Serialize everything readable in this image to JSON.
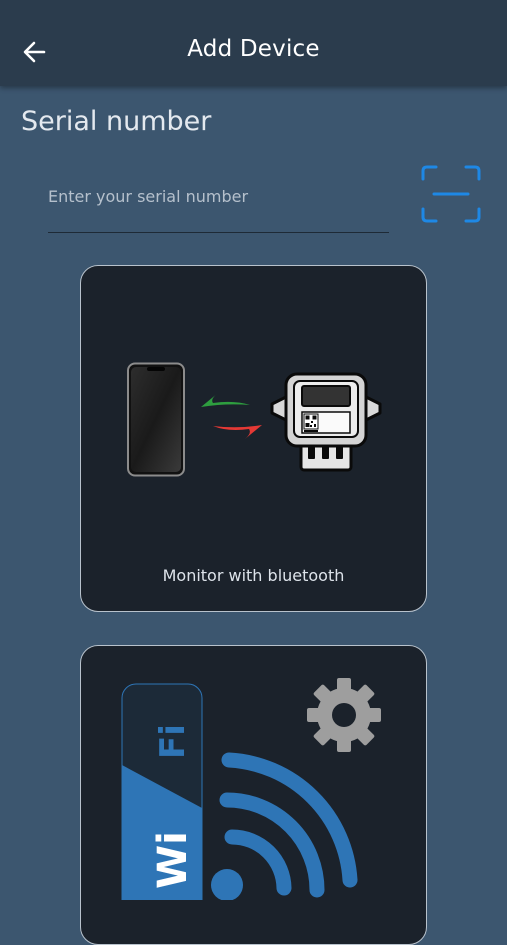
{
  "header": {
    "title": "Add Device"
  },
  "serial": {
    "section_title": "Serial number",
    "placeholder": "Enter your serial number",
    "value": ""
  },
  "options": [
    {
      "label": "Monitor with bluetooth"
    }
  ],
  "wifi_logo": {
    "wi": "Wi",
    "fi": "Fi"
  },
  "colors": {
    "background": "#3c566f",
    "appbar": "#2b3c4d",
    "card": "#1b222b",
    "scan_accent": "#1e88e5",
    "wifi_blue": "#2e75b6",
    "gear": "#9e9e9e",
    "arrow_green": "#2e9e3f",
    "arrow_red": "#e53935"
  },
  "icons": [
    "back-arrow-icon",
    "qr-scan-icon",
    "smartphone-icon",
    "transfer-arrows-icon",
    "smart-meter-icon",
    "wifi-logo-icon",
    "gear-icon",
    "wifi-signal-icon"
  ]
}
